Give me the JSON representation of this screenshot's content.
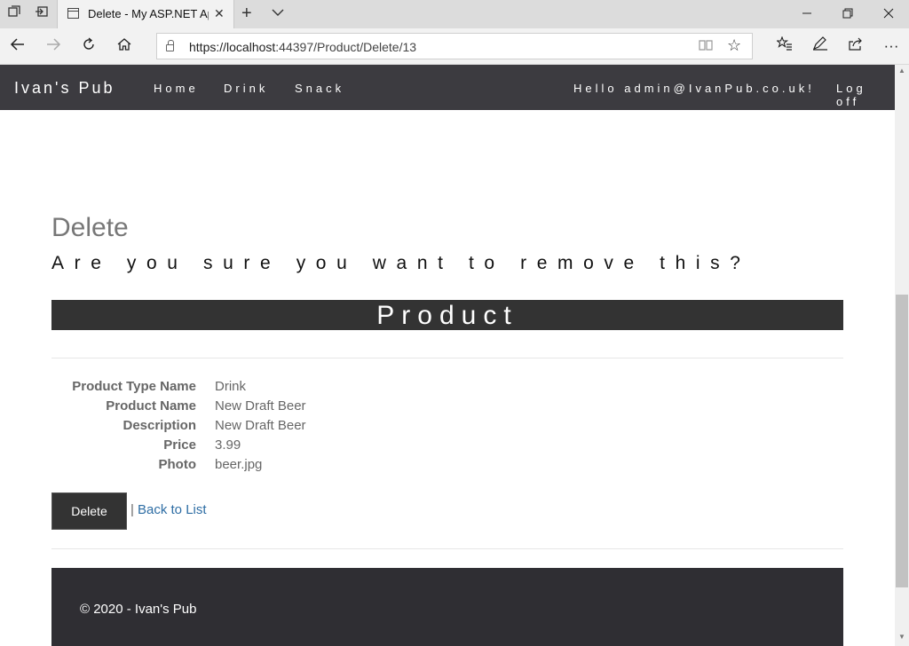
{
  "browser": {
    "tab_title": "Delete - My ASP.NET App",
    "url_host": "https://localhost",
    "url_rest": ":44397/Product/Delete/13",
    "icons": {
      "tab_switch": "tab-stack-icon",
      "set_aside": "tabs-aside-icon",
      "close": "close-icon",
      "new_tab": "plus-icon",
      "tab_menu": "chevron-down-icon",
      "back": "back-arrow-icon",
      "forward": "forward-arrow-icon",
      "refresh": "refresh-icon",
      "home": "home-icon",
      "lock": "lock-icon",
      "reader": "reading-view-icon",
      "favorite": "star-icon",
      "favorites_hub": "favorites-list-icon",
      "notes": "pen-icon",
      "share": "share-icon",
      "more": "more-icon"
    }
  },
  "site": {
    "brand": "Ivan's Pub",
    "nav": [
      "Home",
      "Drink",
      "Snack"
    ],
    "greeting": "Hello admin@IvanPub.co.uk!",
    "logoff": "Log off"
  },
  "page": {
    "title": "Delete",
    "question": "Are you sure you want to remove this?",
    "banner": "Product",
    "details": [
      {
        "label": "Product Type Name",
        "value": "Drink"
      },
      {
        "label": "Product Name",
        "value": "New Draft Beer"
      },
      {
        "label": "Description",
        "value": "New Draft Beer"
      },
      {
        "label": "Price",
        "value": "3.99"
      },
      {
        "label": "Photo",
        "value": "beer.jpg"
      }
    ],
    "delete_label": "Delete",
    "separator": "|",
    "back_label": "Back to List"
  },
  "footer": {
    "text": "© 2020 - Ivan's Pub"
  }
}
